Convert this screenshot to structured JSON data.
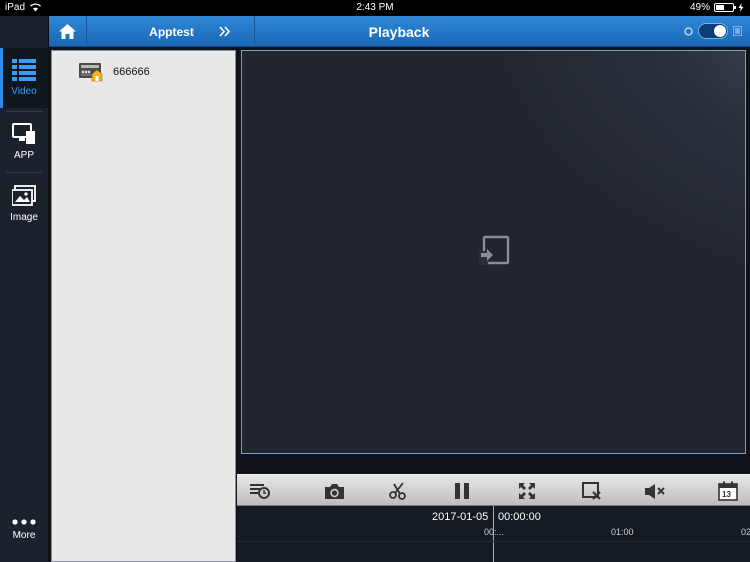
{
  "status_bar": {
    "device": "iPad",
    "time": "2:43 PM",
    "battery": "49%"
  },
  "sidebar": {
    "items": [
      {
        "label": "Video",
        "icon": "video-list-icon",
        "active": true
      },
      {
        "label": "APP",
        "icon": "app-monitor-icon",
        "active": false
      },
      {
        "label": "Image",
        "icon": "image-gallery-icon",
        "active": false
      },
      {
        "label": "More",
        "icon": "more-dots-icon",
        "active": false
      }
    ]
  },
  "topbar": {
    "breadcrumb": "Apptest",
    "title": "Playback"
  },
  "devices": [
    {
      "name": "666666",
      "icon": "dvr-device-icon"
    }
  ],
  "toolbar": {
    "tools": [
      "playback-record-icon",
      "camera-icon",
      "scissors-icon",
      "pause-icon",
      "fullscreen-icon",
      "close-window-icon",
      "mute-icon",
      "calendar-icon"
    ],
    "calendar_day": "13"
  },
  "timeline": {
    "date": "2017-01-05",
    "time": "00:00:00",
    "ticks": [
      "00:...",
      "01:00",
      "02"
    ]
  },
  "colors": {
    "accent": "#2d8be6",
    "cursor": "#e1a91e"
  }
}
